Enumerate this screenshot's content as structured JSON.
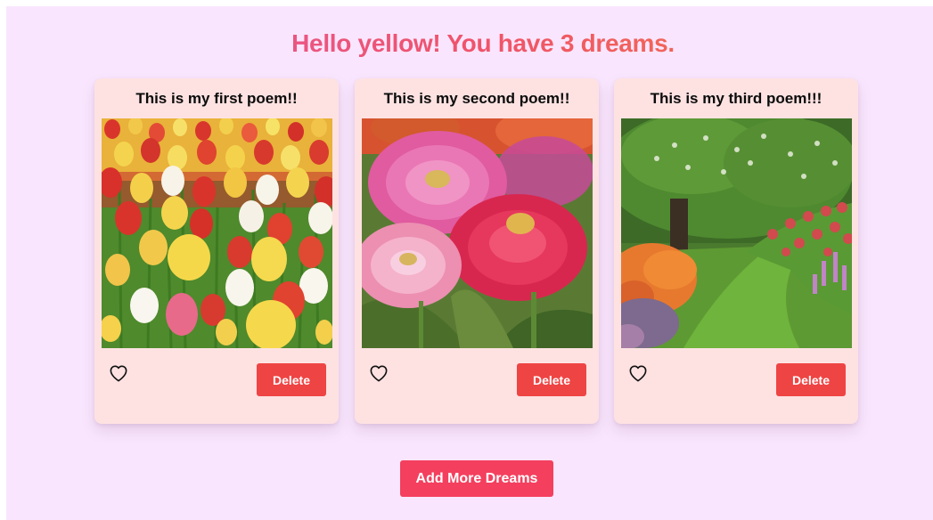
{
  "greeting": {
    "text": "Hello yellow! You have 3 dreams.",
    "gradient_colors": [
      "#e25aa6",
      "#f0536a",
      "#f37f3f"
    ]
  },
  "dreams": [
    {
      "title": "This is my first poem!!",
      "image": "tulip-field-photo",
      "like_icon": "heart-outline-icon",
      "delete_label": "Delete"
    },
    {
      "title": "This is my second poem!!",
      "image": "pink-zinnias-photo",
      "like_icon": "heart-outline-icon",
      "delete_label": "Delete"
    },
    {
      "title": "This is my third poem!!!",
      "image": "garden-path-photo",
      "like_icon": "heart-outline-icon",
      "delete_label": "Delete"
    }
  ],
  "add_more_label": "Add More Dreams",
  "colors": {
    "page_background": "#f9e6fe",
    "card_background": "#fee2e2",
    "delete_button": "#ef4444",
    "add_button": "#f43f5e"
  }
}
